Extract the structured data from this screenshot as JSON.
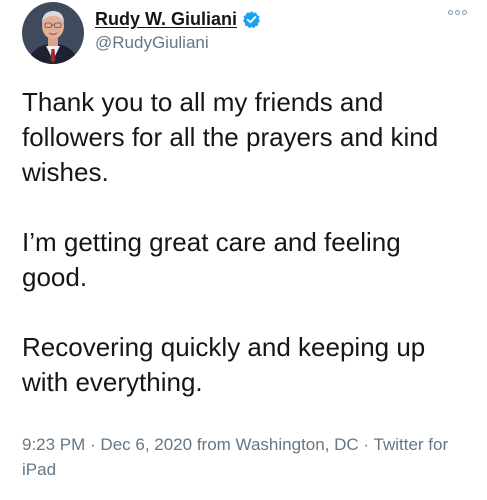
{
  "author": {
    "name": "Rudy W. Giuliani",
    "handle": "@RudyGiuliani",
    "verified_icon": "verified-badge-icon",
    "avatar_icon": "profile-avatar"
  },
  "menu": {
    "icon": "more-options-icon"
  },
  "tweet": {
    "paragraphs": [
      "Thank you to all my friends and followers for all the prayers and kind wishes.",
      "I’m getting great care and feeling good.",
      "Recovering quickly and keeping up with everything."
    ]
  },
  "meta": {
    "time": "9:23 PM",
    "separator": " · ",
    "date": "Dec 6, 2020",
    "location": " from Washington, DC",
    "source": "Twitter for iPad"
  },
  "colors": {
    "text": "#14171a",
    "secondary": "#657786",
    "verified": "#1da1f2"
  }
}
